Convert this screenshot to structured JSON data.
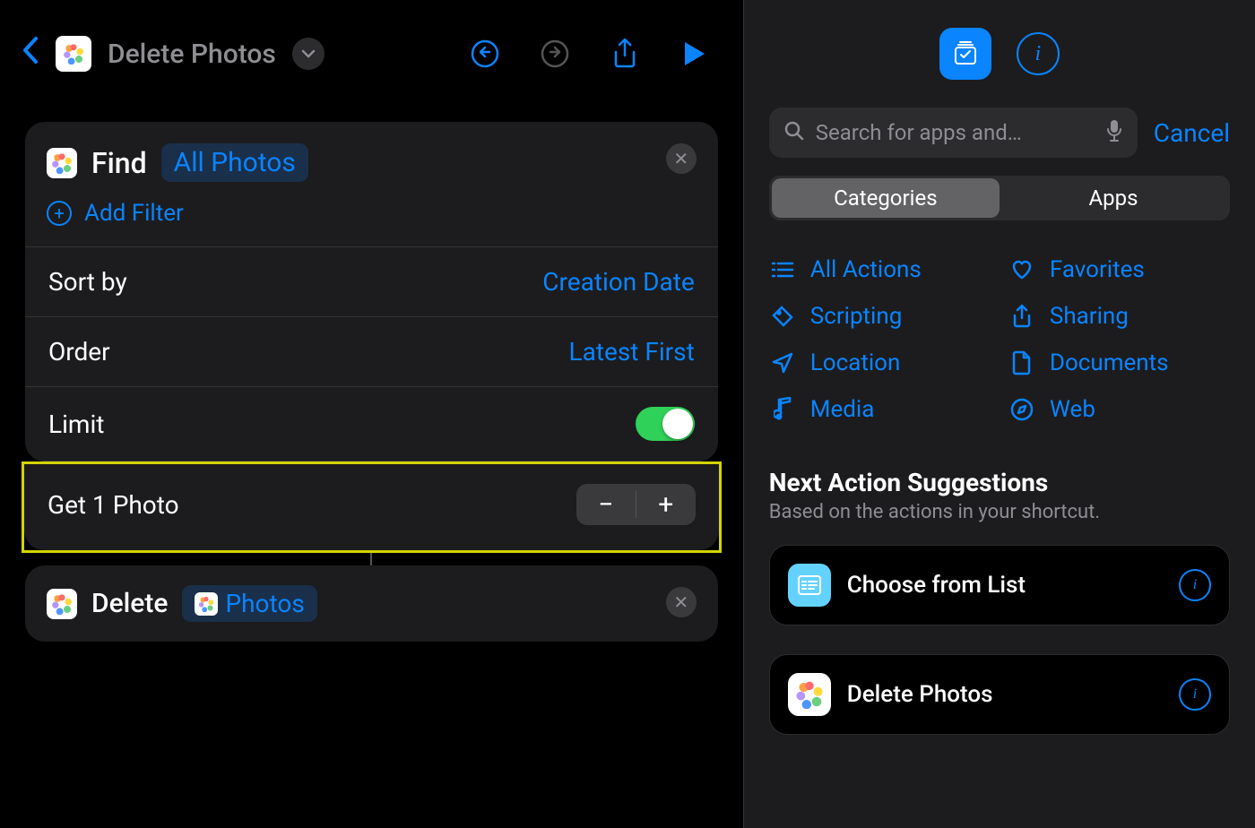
{
  "header": {
    "title": "Delete Photos"
  },
  "find_action": {
    "label": "Find",
    "source": "All Photos",
    "add_filter": "Add Filter",
    "rows": {
      "sort_by_label": "Sort by",
      "sort_by_value": "Creation Date",
      "order_label": "Order",
      "order_value": "Latest First",
      "limit_label": "Limit",
      "get_text": "Get 1 Photo"
    }
  },
  "delete_action": {
    "label": "Delete",
    "param": "Photos"
  },
  "search": {
    "placeholder": "Search for apps and…",
    "cancel": "Cancel"
  },
  "segments": {
    "categories": "Categories",
    "apps": "Apps"
  },
  "categories": {
    "all_actions": "All Actions",
    "favorites": "Favorites",
    "scripting": "Scripting",
    "sharing": "Sharing",
    "location": "Location",
    "documents": "Documents",
    "media": "Media",
    "web": "Web"
  },
  "suggestions": {
    "title": "Next Action Suggestions",
    "subtitle": "Based on the actions in your shortcut.",
    "items": {
      "choose": "Choose from List",
      "delete": "Delete Photos"
    }
  }
}
